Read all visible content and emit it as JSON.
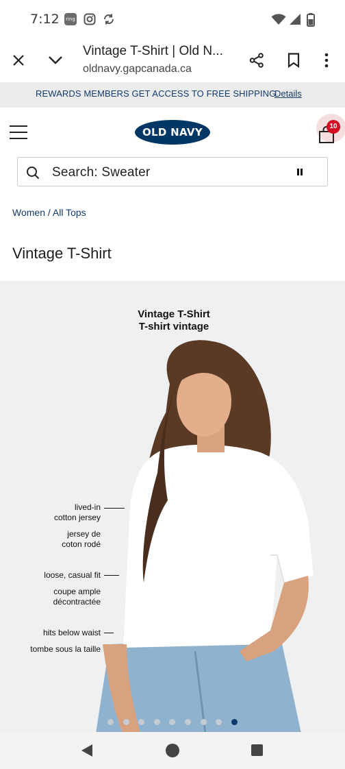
{
  "status_bar": {
    "time": "7:12",
    "ring_label": "ring",
    "icons": [
      "ring-app-icon",
      "instagram-icon",
      "sync-icon",
      "wifi-icon",
      "signal-icon",
      "battery-icon"
    ]
  },
  "browser": {
    "page_title": "Vintage T-Shirt | Old N...",
    "domain": "oldnavy.gapcanada.ca",
    "icons": [
      "close-icon",
      "chevron-down-icon",
      "share-icon",
      "bookmark-icon",
      "more-vert-icon"
    ]
  },
  "banner": {
    "text": "REWARDS MEMBERS GET ACCESS TO FREE SHIPPING",
    "link": "Details"
  },
  "header": {
    "logo": "OLD NAVY",
    "bag_count": "10",
    "icons": [
      "menu-icon",
      "shopping-bag-icon"
    ]
  },
  "search": {
    "placeholder": "Search: Sweater"
  },
  "breadcrumb": "Women / All Tops",
  "product": {
    "title": "Vintage T-Shirt"
  },
  "image": {
    "heading_en": "Vintage T-Shirt",
    "heading_fr": "T-shirt vintage",
    "callouts": [
      {
        "line1": "lived-in",
        "line2": "cotton jersey"
      },
      {
        "line1": "jersey de",
        "line2": "coton rodé"
      },
      {
        "line1": "loose, casual fit",
        "line2": ""
      },
      {
        "line1": "coupe ample",
        "line2": "décontractée"
      },
      {
        "line1": "hits below waist",
        "line2": ""
      },
      {
        "line1": "tombe sous la taille",
        "line2": ""
      }
    ],
    "carousel": {
      "total": 9,
      "active": 9
    }
  },
  "colors": {
    "navy": "#003764",
    "banner_bg": "#ececec",
    "bag_badge": "#d50d23"
  }
}
